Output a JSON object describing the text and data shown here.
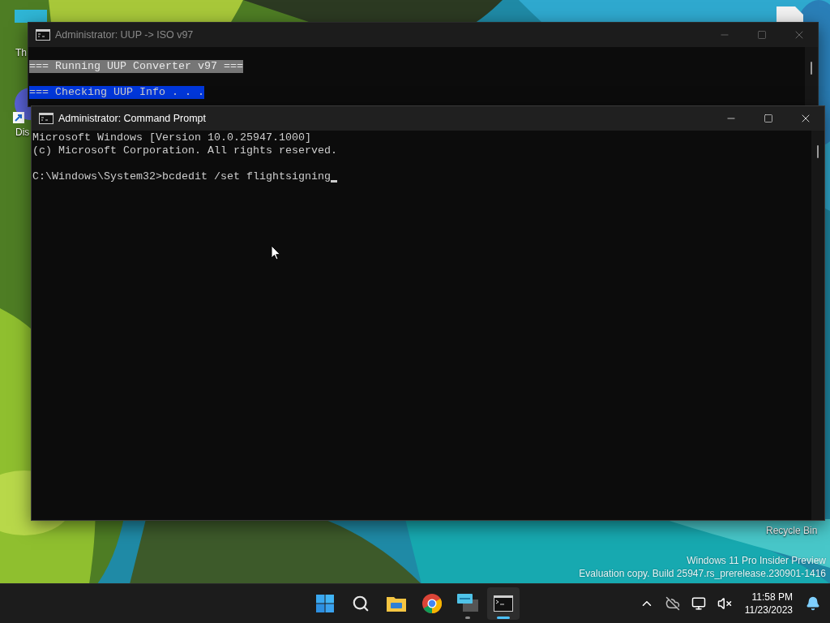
{
  "desktop": {
    "icons": [
      {
        "kind": "tile",
        "label": "Th"
      },
      {
        "kind": "shortcut",
        "label": "Dis"
      },
      {
        "kind": "bin",
        "label": "Recycle Bin"
      }
    ],
    "watermark": [
      "Windows 11 Pro Insider Preview",
      "Evaluation copy. Build 25947.rs_prerelease.230901-1416"
    ]
  },
  "windows": [
    {
      "title": "Administrator:  UUP -> ISO v97",
      "focused": false,
      "cursor": false,
      "lines": [
        {
          "kind": "gray",
          "text": "=== Running UUP Converter v97 ==="
        },
        {
          "kind": "blank"
        },
        {
          "kind": "blue",
          "text": "=== Checking UUP Info . . ."
        }
      ]
    },
    {
      "title": "Administrator: Command Prompt",
      "focused": true,
      "cursor": true,
      "lines": [
        {
          "kind": "plain",
          "text": "Microsoft Windows [Version 10.0.25947.1000]"
        },
        {
          "kind": "plain",
          "text": "(c) Microsoft Corporation. All rights reserved."
        },
        {
          "kind": "blank"
        },
        {
          "kind": "plain",
          "text": "C:\\Windows\\System32>bcdedit /set flightsigning"
        }
      ]
    }
  ],
  "taskbar": {
    "apps": [
      {
        "kind": "start",
        "selected": false,
        "running": false
      },
      {
        "kind": "search",
        "selected": false,
        "running": false
      },
      {
        "kind": "folder",
        "selected": false,
        "running": false
      },
      {
        "kind": "browser",
        "selected": false,
        "running": false
      },
      {
        "kind": "remote",
        "selected": false,
        "running": true
      },
      {
        "kind": "terminal",
        "selected": true,
        "running": true
      }
    ],
    "clock": {
      "time": "11:58 PM",
      "date": "11/23/2023"
    }
  }
}
